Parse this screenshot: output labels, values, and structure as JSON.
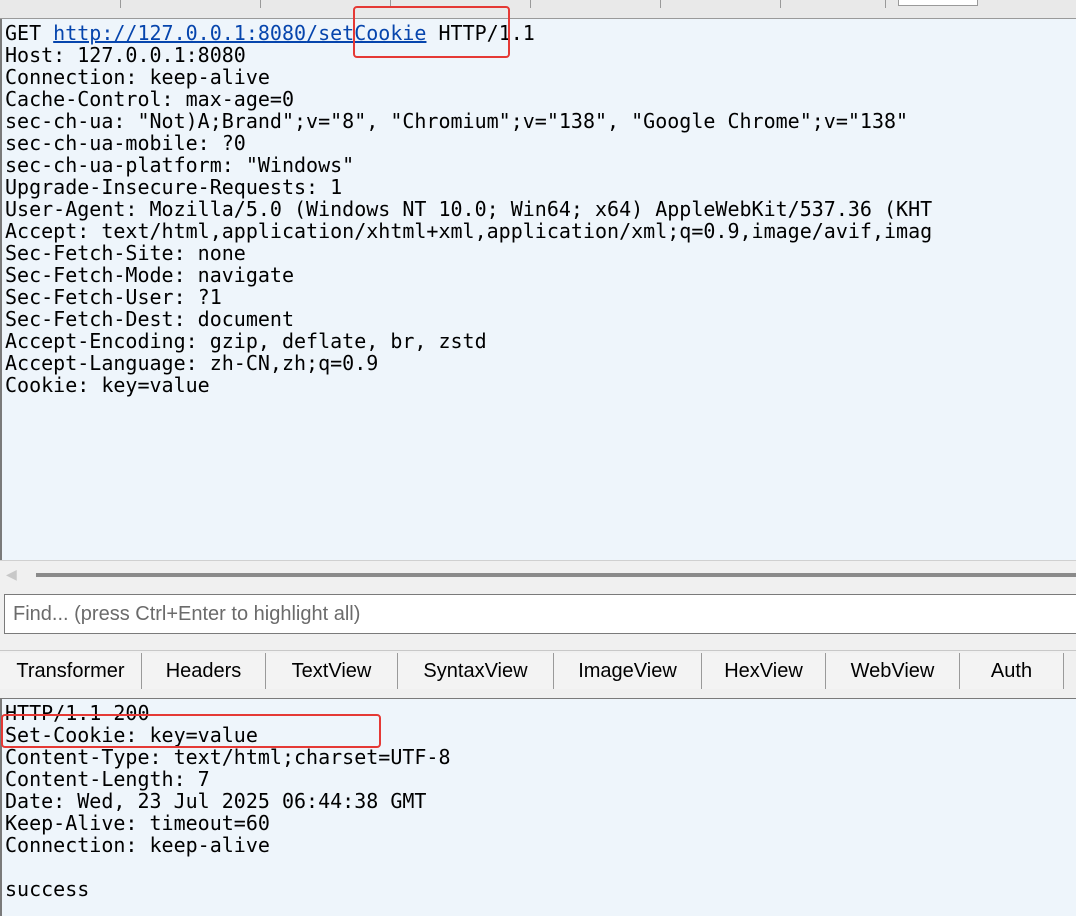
{
  "request": {
    "method": "GET",
    "url_host": "http://127.0.0.1:8080",
    "url_path": "/setCookie",
    "protocol": "HTTP/1.1",
    "headers": [
      "Host: 127.0.0.1:8080",
      "Connection: keep-alive",
      "Cache-Control: max-age=0",
      "sec-ch-ua: \"Not)A;Brand\";v=\"8\", \"Chromium\";v=\"138\", \"Google Chrome\";v=\"138\"",
      "sec-ch-ua-mobile: ?0",
      "sec-ch-ua-platform: \"Windows\"",
      "Upgrade-Insecure-Requests: 1",
      "User-Agent: Mozilla/5.0 (Windows NT 10.0; Win64; x64) AppleWebKit/537.36 (KHT",
      "Accept: text/html,application/xhtml+xml,application/xml;q=0.9,image/avif,imag",
      "Sec-Fetch-Site: none",
      "Sec-Fetch-Mode: navigate",
      "Sec-Fetch-User: ?1",
      "Sec-Fetch-Dest: document",
      "Accept-Encoding: gzip, deflate, br, zstd",
      "Accept-Language: zh-CN,zh;q=0.9",
      "Cookie: key=value"
    ]
  },
  "find": {
    "placeholder": "Find... (press Ctrl+Enter to highlight all)"
  },
  "inspector_tabs": [
    {
      "label": "Transformer"
    },
    {
      "label": "Headers"
    },
    {
      "label": "TextView"
    },
    {
      "label": "SyntaxView"
    },
    {
      "label": "ImageView"
    },
    {
      "label": "HexView"
    },
    {
      "label": "WebView"
    },
    {
      "label": "Auth"
    }
  ],
  "response": {
    "lines": [
      "HTTP/1.1 200",
      "Set-Cookie: key=value",
      "Content-Type: text/html;charset=UTF-8",
      "Content-Length: 7",
      "Date: Wed, 23 Jul 2025 06:44:38 GMT",
      "Keep-Alive: timeout=60",
      "Connection: keep-alive",
      "",
      "success"
    ]
  },
  "colors": {
    "pane_background": "#eef5fb",
    "link": "#0645ad",
    "highlight_box": "#e53935"
  }
}
